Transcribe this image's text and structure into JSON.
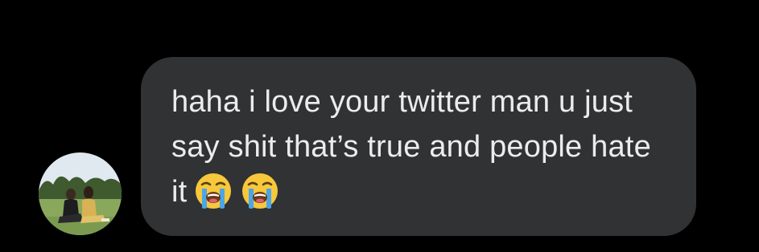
{
  "conversation": {
    "message": {
      "text": "haha i love your twitter man u just say shit that’s true and people hate it",
      "emojis": [
        "loudly-crying-face-icon",
        "loudly-crying-face-icon"
      ],
      "bubble_color": "#303234",
      "text_color": "#ececec"
    },
    "sender": {
      "avatar_icon": "avatar-photo"
    }
  },
  "colors": {
    "background": "#000000"
  }
}
